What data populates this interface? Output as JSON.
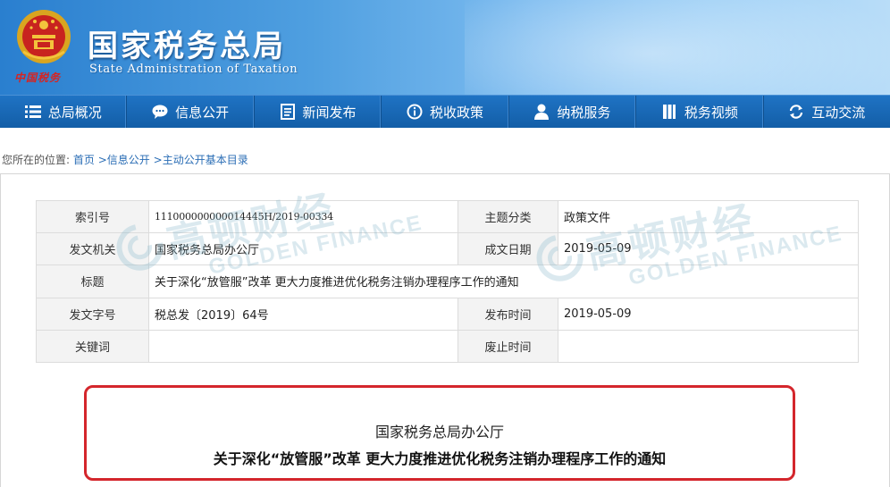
{
  "header": {
    "title": "国家税务总局",
    "subtitle": "State Administration of Taxation",
    "emblem_caption": "中国税务"
  },
  "nav": {
    "items": [
      {
        "label": "总局概况",
        "icon": "list-menu-icon"
      },
      {
        "label": "信息公开",
        "icon": "speech-bubble-icon"
      },
      {
        "label": "新闻发布",
        "icon": "document-icon"
      },
      {
        "label": "税收政策",
        "icon": "info-circle-icon"
      },
      {
        "label": "纳税服务",
        "icon": "user-icon"
      },
      {
        "label": "税务视频",
        "icon": "film-icon"
      },
      {
        "label": "互动交流",
        "icon": "refresh-arrows-icon"
      }
    ]
  },
  "breadcrumb": {
    "prefix": "您所在的位置:",
    "items": [
      "首页",
      "信息公开",
      "主动公开基本目录"
    ],
    "separator": ">"
  },
  "info": {
    "index_label": "索引号",
    "index_value": "111000000000014445H/2019-00334",
    "category_label": "主题分类",
    "category_value": "政策文件",
    "issuer_label": "发文机关",
    "issuer_value": "国家税务总局办公厅",
    "created_label": "成文日期",
    "created_value": "2019-05-09",
    "title_label": "标题",
    "title_value": "关于深化“放管服”改革 更大力度推进优化税务注销办理程序工作的通知",
    "docno_label": "发文字号",
    "docno_value": "税总发〔2019〕64号",
    "published_label": "发布时间",
    "published_value": "2019-05-09",
    "keywords_label": "关键词",
    "keywords_value": "",
    "repealed_label": "废止时间",
    "repealed_value": ""
  },
  "watermark": {
    "cn": "高顿财经",
    "en": "GOLDEN FINANCE"
  },
  "notice": {
    "org": "国家税务总局办公厅",
    "title": "关于深化“放管服”改革 更大力度推进优化税务注销办理程序工作的通知"
  },
  "colors": {
    "nav_bg": "#135ea7",
    "header_start": "#2a7fcf",
    "header_end": "#b9ddf8",
    "notice_border": "#d4262c",
    "link": "#2a6db5"
  }
}
